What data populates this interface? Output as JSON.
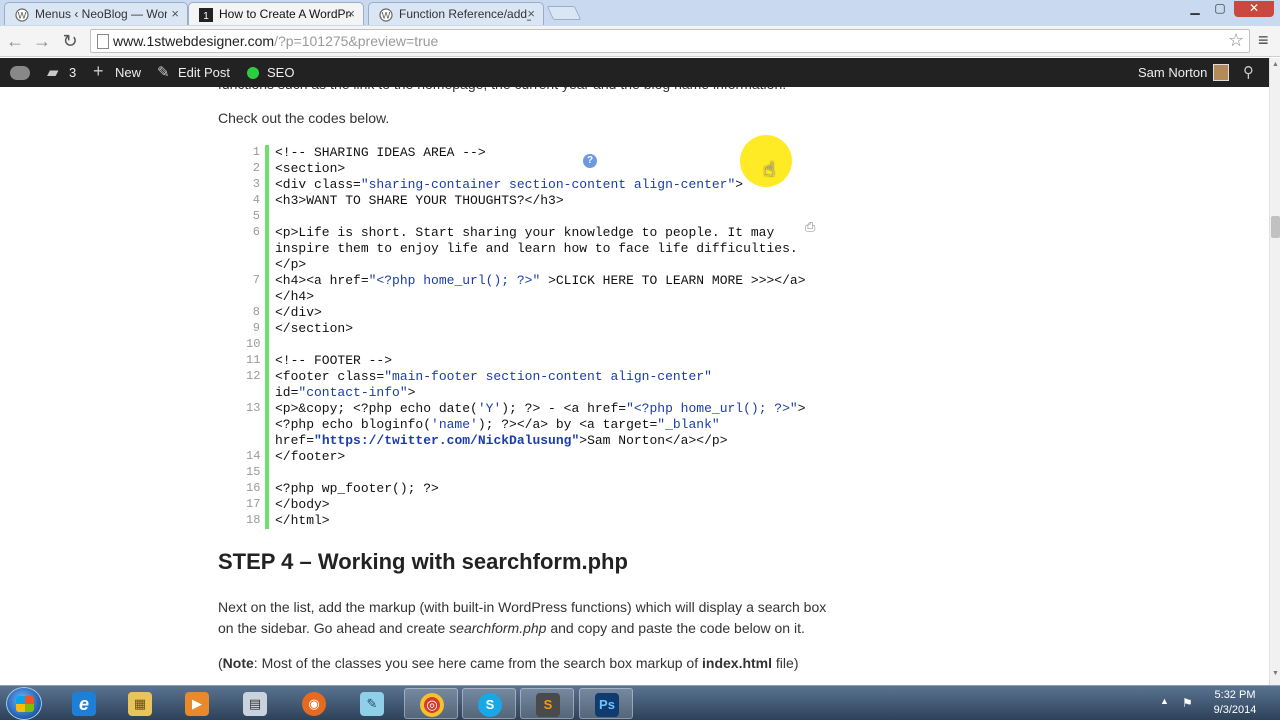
{
  "browser": {
    "tabs": [
      {
        "title": "Menus ‹ NeoBlog — Wordpress",
        "close": "×"
      },
      {
        "title": "How to Create A WordPress",
        "close": "×"
      },
      {
        "title": "Function Reference/add_a",
        "close": "×"
      }
    ],
    "window_controls": {
      "minimize": "▁",
      "maximize": "▢",
      "close": "✕"
    },
    "nav": {
      "back": "←",
      "forward": "→",
      "reload": "↻"
    },
    "url_host": "www.1stwebdesigner.com",
    "url_rest": "/?p=101275&preview=true",
    "star": "☆",
    "menu": "≡"
  },
  "adminbar": {
    "comments_count": "3",
    "new_label": "New",
    "edit_label": "Edit Post",
    "seo_label": "SEO",
    "user_name": "Sam Norton",
    "search_icon": "search-icon",
    "icons": {
      "comment": "▰",
      "plus": "+",
      "pencil": "✎",
      "search": "⚲"
    }
  },
  "article": {
    "clipped_text": "functions such as the link to the homepage, the current year and the blog name information.",
    "check_text": "Check out the codes below.",
    "code_lines": [
      {
        "n": "1",
        "text": "<!-- SHARING IDEAS AREA -->"
      },
      {
        "n": "2",
        "text": "<section>"
      },
      {
        "n": "3",
        "a": "<div class=",
        "b": "\"sharing-container section-content align-center\"",
        "c": ">"
      },
      {
        "n": "4",
        "text": "<h3>WANT TO SHARE YOUR THOUGHTS?</h3>"
      },
      {
        "n": "5",
        "text": ""
      },
      {
        "n": "6",
        "text": "<p>Life is short. Start sharing your knowledge to people. It may"
      },
      {
        "n": "",
        "text": "inspire them to enjoy life and learn how to face life difficulties."
      },
      {
        "n": "",
        "text": "</p>"
      },
      {
        "n": "7",
        "a": "<h4><a href=",
        "b": "\"<?php home_url(); ?>\"",
        "c": " >CLICK HERE TO LEARN MORE >>></a>"
      },
      {
        "n": "",
        "text": "</h4>"
      },
      {
        "n": "8",
        "text": "</div>"
      },
      {
        "n": "9",
        "text": "</section>"
      },
      {
        "n": "10",
        "text": ""
      },
      {
        "n": "11",
        "text": "<!-- FOOTER -->"
      },
      {
        "n": "12",
        "a": "<footer class=",
        "b": "\"main-footer section-content align-center\"",
        "c": ""
      },
      {
        "n": "",
        "a": "id=",
        "b": "\"contact-info\"",
        "c": ">"
      },
      {
        "n": "13",
        "a": "<p>&copy; <?php echo date(",
        "b": "'Y'",
        "c": "); ?> - <a href=",
        "d": "\"<?php home_url(); ?>\"",
        "e": ">"
      },
      {
        "n": "",
        "a": "<?php echo bloginfo(",
        "b": "'name'",
        "c": "); ?></a> by <a target=",
        "d": "\"_blank\"",
        "e": ""
      },
      {
        "n": "",
        "a": "href=",
        "bb": "\"https://twitter.com/NickDalusung\"",
        "c": ">Sam Norton</a></p>"
      },
      {
        "n": "14",
        "text": "</footer>"
      },
      {
        "n": "15",
        "text": ""
      },
      {
        "n": "16",
        "text": "<?php wp_footer(); ?>"
      },
      {
        "n": "17",
        "text": "</body>"
      },
      {
        "n": "18",
        "text": "</html>"
      }
    ],
    "code_tools": {
      "view_source": "⚙",
      "print": "⎙",
      "help": "?"
    },
    "step_heading": "STEP 4 – Working with searchform.php",
    "desc_line1": "Next on the list, add the markup (with built-in WordPress functions) which will display a search box",
    "desc_line2_a": "on the sidebar. Go ahead and create ",
    "desc_line2_em": "searchform.php",
    "desc_line2_b": " and copy and paste the code below on it.",
    "note_open": "(",
    "note_label": "Note",
    "note_mid": ": Most of the classes you see here came from the search box markup of ",
    "note_file": "index.html",
    "note_end": " file)"
  },
  "taskbar": {
    "apps": [
      "Internet Explorer",
      "Windows Explorer",
      "Media Player",
      "Calculator",
      "Firefox",
      "Notepad",
      "Chrome",
      "Skype",
      "Sublime Text",
      "Photoshop"
    ],
    "app_glyphs": {
      "ie": "e",
      "explorer": "▦",
      "media": "▶",
      "calc": "▤",
      "firefox": "◉",
      "notepad": "✎",
      "chrome": "◎",
      "skype": "S",
      "sublime": "S",
      "ps": "Ps"
    },
    "tray_arrow": "▲",
    "tray_flag": "⚑",
    "time": "5:32 PM",
    "date": "9/3/2014"
  },
  "colors": {
    "adminbar_bg": "#222222",
    "code_gutter": "#6ce26c",
    "code_string": "#1a3ea8",
    "highlight": "#ffe600"
  }
}
